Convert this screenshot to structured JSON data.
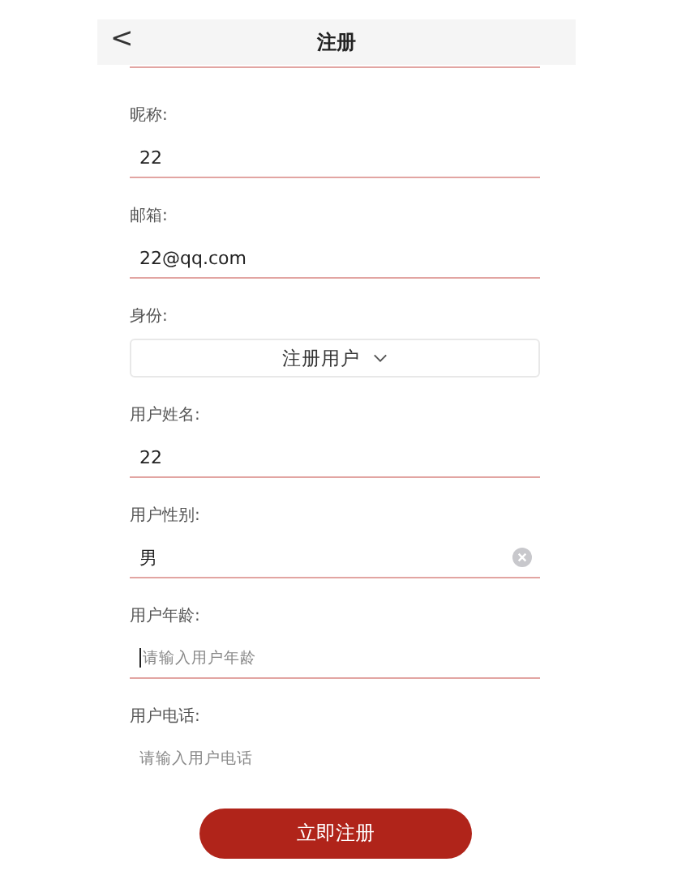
{
  "header": {
    "back": "<",
    "title": "注册"
  },
  "fields": [
    {
      "kind": "input",
      "label": "昵称:",
      "value": "22",
      "underlined": true,
      "clearable": false
    },
    {
      "kind": "input",
      "label": "邮箱:",
      "value": "22@qq.com",
      "underlined": true,
      "clearable": false
    },
    {
      "kind": "select",
      "label": "身份:",
      "value": "注册用户"
    },
    {
      "kind": "input",
      "label": "用户姓名:",
      "value": "22",
      "underlined": true,
      "clearable": false
    },
    {
      "kind": "input",
      "label": "用户性别:",
      "value": "男",
      "underlined": true,
      "clearable": true
    },
    {
      "kind": "input",
      "label": "用户年龄:",
      "placeholder": "请输入用户年龄",
      "underlined": true,
      "clearable": false,
      "focused": true
    },
    {
      "kind": "input",
      "label": "用户电话:",
      "placeholder": "请输入用户电话",
      "underlined": false,
      "clearable": false
    }
  ],
  "submit": "立即注册"
}
